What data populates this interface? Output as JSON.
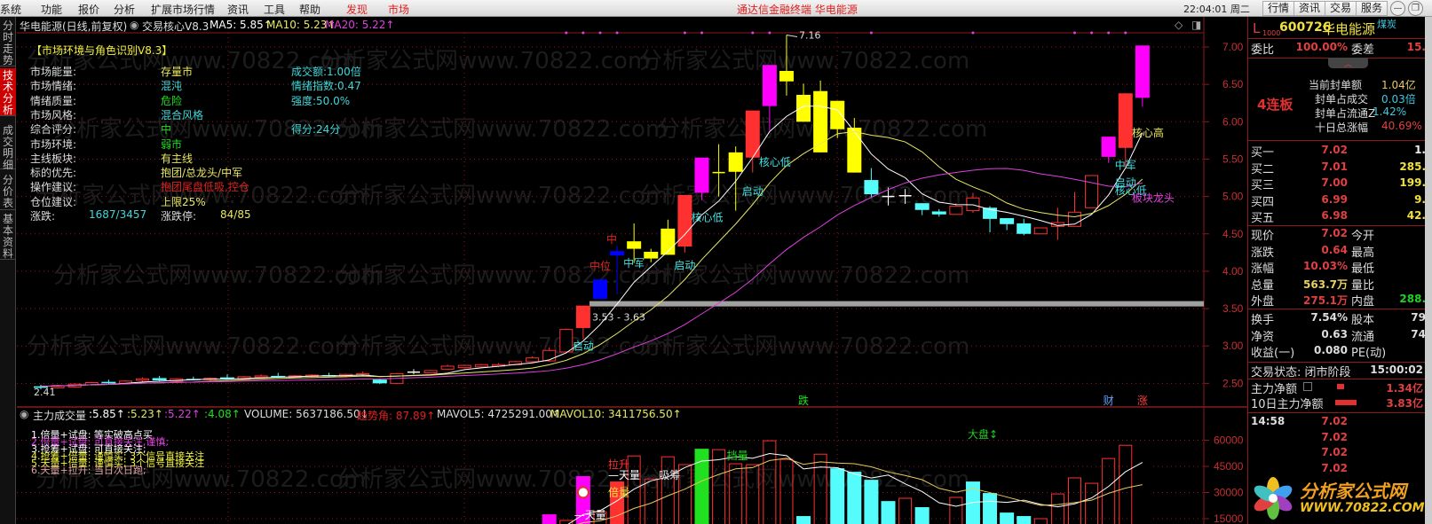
{
  "menu": {
    "items": [
      "系统",
      "功能",
      "报价",
      "分析",
      "扩展市场行情",
      "资讯",
      "工具",
      "帮助"
    ],
    "highlight": [
      "发现",
      "市场"
    ],
    "center_title": "通达信金融终端  华电能源",
    "clock": "22:04:01 周二",
    "buttons": [
      "行情",
      "资讯",
      "交易",
      "服务"
    ]
  },
  "sidetabs": [
    "分时走势",
    "技术分析",
    "成交明细",
    "分价表",
    "基本资料"
  ],
  "title": {
    "stock": "华电能源(日线,前复权)",
    "indicator": "交易核心V8.3",
    "ma5": "MA5: 5.85↑",
    "ma10": "MA10: 5.23↑",
    "ma20": "MA20: 5.22↑"
  },
  "panel": {
    "title": "【市场环境与角色识别V8.3】",
    "rows": [
      {
        "label": "市场能量:",
        "value": "存量市",
        "vcolor": "#e8e860",
        "extra": "成交额:1.00倍"
      },
      {
        "label": "市场情绪:",
        "value": "混沌",
        "vcolor": "#40d8d8",
        "extra": "情绪指数:0.47"
      },
      {
        "label": "情绪质量:",
        "value": "危险",
        "vcolor": "#20e020",
        "extra": "强度:50.0%"
      },
      {
        "label": "市场风格:",
        "value": "混合风格",
        "vcolor": "#40d8d8",
        "extra": ""
      },
      {
        "label": "综合评分:",
        "value": "中",
        "vcolor": "#20e020",
        "extra": "得分:24分"
      },
      {
        "label": "市场环境:",
        "value": "弱市",
        "vcolor": "#20e020",
        "extra": ""
      },
      {
        "label": "主线板块:",
        "value": "有主线",
        "vcolor": "#e8e860",
        "extra": ""
      },
      {
        "label": "标的优先:",
        "value": "抱团/总龙头/中军",
        "vcolor": "#e8e860",
        "extra": ""
      },
      {
        "label": "操作建议:",
        "value": "抱团尾盘低吸,控仓",
        "vcolor": "#e02020",
        "extra": ""
      },
      {
        "label": "仓位建议:",
        "value": "上限25%",
        "vcolor": "#e8e860",
        "extra": ""
      }
    ],
    "zd_label": "涨跌:",
    "zd_value": "1687/3457",
    "zdt_label": "涨跌停:",
    "zdt_value": "84/85"
  },
  "chart": {
    "price_ticks": [
      "7.00",
      "6.50",
      "6.00",
      "5.50",
      "5.00",
      "4.50",
      "4.00",
      "3.50",
      "3.00",
      "2.50"
    ],
    "high_label": "7.16",
    "low_label": "2.41",
    "band_label": "3.53 - 3.63",
    "annotations": [
      {
        "text": "启动",
        "color": "#40e0e0",
        "i": 32,
        "p": 2.95
      },
      {
        "text": "中位",
        "color": "#e02020",
        "i": 33,
        "p": 4.02
      },
      {
        "text": "中",
        "color": "#e02020",
        "i": 34,
        "p": 4.38
      },
      {
        "text": "中军",
        "color": "#40e0e0",
        "i": 35,
        "p": 4.06
      },
      {
        "text": "启动",
        "color": "#40e0e0",
        "i": 38,
        "p": 4.03
      },
      {
        "text": "核心低",
        "color": "#40e0e0",
        "i": 39,
        "p": 4.67
      },
      {
        "text": "启动",
        "color": "#40e0e0",
        "i": 42,
        "p": 5.02
      },
      {
        "text": "核心低",
        "color": "#40e0e0",
        "i": 43,
        "p": 5.41
      },
      {
        "text": "核心高",
        "color": "#e8e860",
        "i": 65,
        "p": 5.8
      },
      {
        "text": "中军",
        "color": "#40e0e0",
        "i": 64,
        "p": 5.37
      },
      {
        "text": "启动",
        "color": "#40e0e0",
        "i": 64,
        "p": 5.14
      },
      {
        "text": "核心低",
        "color": "#40e0e0",
        "i": 64,
        "p": 5.03
      },
      {
        "text": "板块龙头",
        "color": "#e040e0",
        "i": 65,
        "p": 4.93
      }
    ],
    "dots": [
      31,
      32,
      33,
      34,
      38,
      39,
      42,
      43,
      49,
      55,
      61,
      62,
      63,
      64
    ],
    "candles": [
      [
        2.44,
        2.48,
        2.42,
        2.46,
        "d"
      ],
      [
        2.44,
        2.48,
        2.43,
        2.47,
        "u"
      ],
      [
        2.45,
        2.5,
        2.44,
        2.49,
        "u"
      ],
      [
        2.48,
        2.52,
        2.47,
        2.51,
        "u"
      ],
      [
        2.52,
        2.55,
        2.49,
        2.5,
        "d"
      ],
      [
        2.5,
        2.54,
        2.49,
        2.53,
        "u"
      ],
      [
        2.54,
        2.58,
        2.52,
        2.56,
        "u"
      ],
      [
        2.57,
        2.6,
        2.53,
        2.54,
        "d"
      ],
      [
        2.53,
        2.57,
        2.52,
        2.56,
        "u"
      ],
      [
        2.56,
        2.59,
        2.54,
        2.55,
        "d"
      ],
      [
        2.55,
        2.58,
        2.53,
        2.57,
        "u"
      ],
      [
        2.58,
        2.62,
        2.55,
        2.56,
        "d"
      ],
      [
        2.56,
        2.6,
        2.55,
        2.59,
        "u"
      ],
      [
        2.59,
        2.62,
        2.57,
        2.6,
        "u"
      ],
      [
        2.6,
        2.64,
        2.58,
        2.59,
        "d"
      ],
      [
        2.58,
        2.61,
        2.57,
        2.6,
        "u"
      ],
      [
        2.6,
        2.62,
        2.58,
        2.61,
        "u"
      ],
      [
        2.61,
        2.64,
        2.59,
        2.6,
        "d"
      ],
      [
        2.6,
        2.63,
        2.58,
        2.62,
        "u"
      ],
      [
        2.62,
        2.66,
        2.6,
        2.63,
        "u"
      ],
      [
        2.55,
        2.56,
        2.49,
        2.5,
        "d"
      ],
      [
        2.5,
        2.64,
        2.49,
        2.63,
        "u"
      ],
      [
        2.65,
        2.69,
        2.62,
        2.65,
        "w"
      ],
      [
        2.64,
        2.68,
        2.63,
        2.67,
        "u"
      ],
      [
        2.69,
        2.75,
        2.68,
        2.73,
        "u"
      ],
      [
        2.71,
        2.75,
        2.7,
        2.74,
        "u"
      ],
      [
        2.72,
        2.76,
        2.71,
        2.75,
        "u"
      ],
      [
        2.73,
        2.77,
        2.72,
        2.75,
        "u"
      ],
      [
        2.75,
        2.8,
        2.74,
        2.79,
        "u"
      ],
      [
        2.79,
        2.86,
        2.78,
        2.84,
        "u"
      ],
      [
        2.8,
        2.98,
        2.79,
        2.94,
        "u"
      ],
      [
        2.92,
        3.23,
        2.9,
        3.22,
        "u"
      ],
      [
        3.24,
        3.54,
        3.09,
        3.54,
        "R"
      ],
      [
        3.63,
        3.89,
        3.63,
        3.89,
        "B"
      ],
      [
        4.27,
        4.34,
        3.69,
        4.21,
        "B"
      ],
      [
        4.3,
        4.64,
        4.11,
        4.4,
        "Y"
      ],
      [
        4.17,
        4.3,
        4.12,
        4.26,
        "Y"
      ],
      [
        4.22,
        4.69,
        4.22,
        4.57,
        "Y"
      ],
      [
        4.33,
        5.02,
        4.25,
        5.02,
        "R"
      ],
      [
        5.05,
        5.52,
        4.95,
        5.52,
        "M"
      ],
      [
        5.32,
        5.7,
        5.0,
        5.32,
        "Yx"
      ],
      [
        5.33,
        5.67,
        4.81,
        5.59,
        "Y"
      ],
      [
        5.52,
        6.15,
        5.32,
        6.15,
        "R"
      ],
      [
        6.21,
        6.76,
        5.88,
        6.76,
        "M"
      ],
      [
        6.68,
        7.16,
        6.35,
        6.54,
        "Y"
      ],
      [
        6.36,
        6.51,
        6.0,
        6.0,
        "Y"
      ],
      [
        6.41,
        6.55,
        5.59,
        5.59,
        "Y"
      ],
      [
        6.28,
        6.28,
        5.78,
        5.9,
        "Y"
      ],
      [
        5.92,
        6.05,
        5.32,
        5.32,
        "Y"
      ],
      [
        5.22,
        5.38,
        4.98,
        5.03,
        "d"
      ],
      [
        5.0,
        5.12,
        4.88,
        5.0,
        "w"
      ],
      [
        5.01,
        5.1,
        4.9,
        5.01,
        "w"
      ],
      [
        4.91,
        4.91,
        4.75,
        4.82,
        "d"
      ],
      [
        4.8,
        4.83,
        4.73,
        4.76,
        "d"
      ],
      [
        4.76,
        4.91,
        4.76,
        4.87,
        "u"
      ],
      [
        4.81,
        5.05,
        4.78,
        4.98,
        "u"
      ],
      [
        4.85,
        4.87,
        4.52,
        4.7,
        "d"
      ],
      [
        4.71,
        4.71,
        4.55,
        4.63,
        "d"
      ],
      [
        4.64,
        4.7,
        4.48,
        4.5,
        "d"
      ],
      [
        4.5,
        4.58,
        4.5,
        4.58,
        "u"
      ],
      [
        4.6,
        4.85,
        4.42,
        4.65,
        "u"
      ],
      [
        4.6,
        5.06,
        4.6,
        4.79,
        "u"
      ],
      [
        4.85,
        5.28,
        4.85,
        5.28,
        "u"
      ],
      [
        5.53,
        5.8,
        5.45,
        5.8,
        "M"
      ],
      [
        5.65,
        6.38,
        5.4,
        6.38,
        "R"
      ],
      [
        6.32,
        7.02,
        6.2,
        7.02,
        "M"
      ]
    ]
  },
  "volume": {
    "header": {
      "name": "主力成交量",
      "v1": ":5.85↑",
      "v2": ":5.23↑",
      "v3": ":5.22↑",
      "v4": ":4.08↑",
      "volume": "VOLUME: 5637186.50↓",
      "trend": "趋势角: 87.89↑",
      "mavol5": "MAVOL5: 4725291.00↑",
      "mavol10": "MAVOL10: 3411756.50↑"
    },
    "legend": [
      {
        "text": "1.倍量+试盘: 等实破高点买",
        "color": "#ffffff"
      },
      {
        "text": "2.倍量+试盘: 可直接关注,谨慎;",
        "color": "#e040e0"
      },
      {
        "text": "3.抢筹+试盘: 可直接关注;",
        "color": "#ffffff"
      },
      {
        "text": "4.抢筹+倍量: 谨慎买; 3个信号直接关注",
        "color": "#f0f040"
      },
      {
        "text": "5.天量+倍量: 谨慎买; 3个信号直接关注",
        "color": "#f0f040"
      },
      {
        "text": "6.天量+拉升: 当日次日跑;",
        "color": "#e0a0a0"
      }
    ],
    "ticks": [
      "60000",
      "45000",
      "30000",
      "15000"
    ],
    "markers": [
      {
        "text": "跌",
        "color": "#20e020",
        "i": 45
      },
      {
        "text": "财",
        "color": "#60a0ff",
        "i": 63
      },
      {
        "text": "涨",
        "color": "#ff4040",
        "i": 65
      },
      {
        "text": "大盘↕",
        "color": "#20d020",
        "i": 55
      }
    ],
    "labels": [
      {
        "text": "拉升",
        "color": "#ff3030",
        "i": 33,
        "v": 44000
      },
      {
        "text": "—天量",
        "color": "#ffffff",
        "i": 33,
        "v": 38000
      },
      {
        "text": "吸筹",
        "color": "#dddddd",
        "i": 36,
        "v": 38000
      },
      {
        "text": "倍量",
        "color": "#f0f040",
        "i": 33,
        "v": 28000
      },
      {
        "text": "—天量",
        "color": "#ffffff",
        "i": 31,
        "v": 15000
      },
      {
        "text": "挡量",
        "color": "#20e020",
        "i": 40,
        "v": 49000
      }
    ],
    "values": [
      8000,
      8000,
      8000,
      8000,
      8000,
      8000,
      8000,
      8000,
      8000,
      8000,
      8000,
      8000,
      8000,
      8000,
      8000,
      8000,
      8000,
      8000,
      8000,
      8000,
      8000,
      8000,
      8000,
      8000,
      8000,
      8000,
      8000,
      8000,
      8000,
      8000,
      17500,
      14000,
      39400,
      19000,
      36300,
      51000,
      37800,
      50500,
      46000,
      55100,
      54600,
      46500,
      46000,
      59700,
      49000,
      16500,
      52000,
      43900,
      41900,
      37300,
      25100,
      26700,
      21600,
      10000,
      27200,
      36300,
      29700,
      18500,
      16500,
      15000,
      29200,
      38400,
      35300,
      49500,
      57100,
      56100
    ],
    "types": "MMMMMMMMMMMMMMMMMMMMMMMMMMMMMMMuMuRuuuuGuuuuududddduddudddduuuuuu"
  },
  "right": {
    "code_prefix": "L",
    "code_sub": "1000",
    "code": "600726",
    "name": "华电能源",
    "sector": "煤炭",
    "weibi_label": "委比",
    "weibi": "100.00%",
    "weicha_label": "委差",
    "weicha": "15.",
    "board": "4连板",
    "seal": [
      {
        "label": "当前封单额",
        "value": "1.04亿",
        "color": "#e8c860"
      },
      {
        "label": "封单占成交",
        "value": "0.03倍",
        "color": "#40c8e0"
      },
      {
        "label": "封单占流通Z",
        "value": "1.42%",
        "color": "#40c8e0"
      },
      {
        "label": "十日总涨幅",
        "value": "40.69%",
        "color": "#e04040"
      }
    ],
    "bids": [
      {
        "label": "买一",
        "price": "7.02",
        "vol": "1."
      },
      {
        "label": "买二",
        "price": "7.01",
        "vol": "285."
      },
      {
        "label": "买三",
        "price": "7.00",
        "vol": "199."
      },
      {
        "label": "买四",
        "price": "6.99",
        "vol": "9."
      },
      {
        "label": "买五",
        "price": "6.98",
        "vol": "42."
      }
    ],
    "quote": [
      {
        "l1": "现价",
        "v1": "7.02",
        "c1": "#e04040",
        "l2": "今开",
        "v2": "",
        "c2": "#e04040"
      },
      {
        "l1": "涨跌",
        "v1": "0.64",
        "c1": "#e04040",
        "l2": "最高",
        "v2": "",
        "c2": "#e04040"
      },
      {
        "l1": "涨幅",
        "v1": "10.03%",
        "c1": "#e04040",
        "l2": "最低",
        "v2": "",
        "c2": "#e04040"
      },
      {
        "l1": "总量",
        "v1": "563.7万",
        "c1": "#e8d060",
        "l2": "量比",
        "v2": "",
        "c2": "#e04040"
      },
      {
        "l1": "外盘",
        "v1": "275.1万",
        "c1": "#e04040",
        "l2": "内盘",
        "v2": "288.",
        "c2": "#20d020"
      }
    ],
    "fin": [
      {
        "l1": "换手",
        "v1": "7.54%",
        "l2": "股本",
        "v2": "79"
      },
      {
        "l1": "净资",
        "v1": "0.63",
        "l2": "流通",
        "v2": "74"
      },
      {
        "l1": "收益(一)",
        "v1": "0.080",
        "l2": "PE(动)",
        "v2": ""
      }
    ],
    "status_label": "交易状态: 闭市阶段",
    "status_time": "15:00:02",
    "flow": [
      {
        "label": "主力净额",
        "value": "1.34亿"
      },
      {
        "label": "10日主力净额",
        "value": "3.83亿"
      }
    ],
    "ticks": [
      {
        "time": "14:58",
        "price": "7.02"
      },
      {
        "time": "",
        "price": "7.02"
      },
      {
        "time": "",
        "price": "7.02"
      },
      {
        "time": "",
        "price": "7.02"
      }
    ],
    "logo_name": "分析家公式网",
    "logo_url": "WWW.70822.COM"
  },
  "watermark": "分析家公式网www.70822.com",
  "colors": {
    "up": "#ff3030",
    "down": "#54fcfc",
    "yellow": "#ffff00",
    "magenta": "#ff00ff",
    "blue": "#0000ff",
    "grid": "#8b1a1a"
  }
}
